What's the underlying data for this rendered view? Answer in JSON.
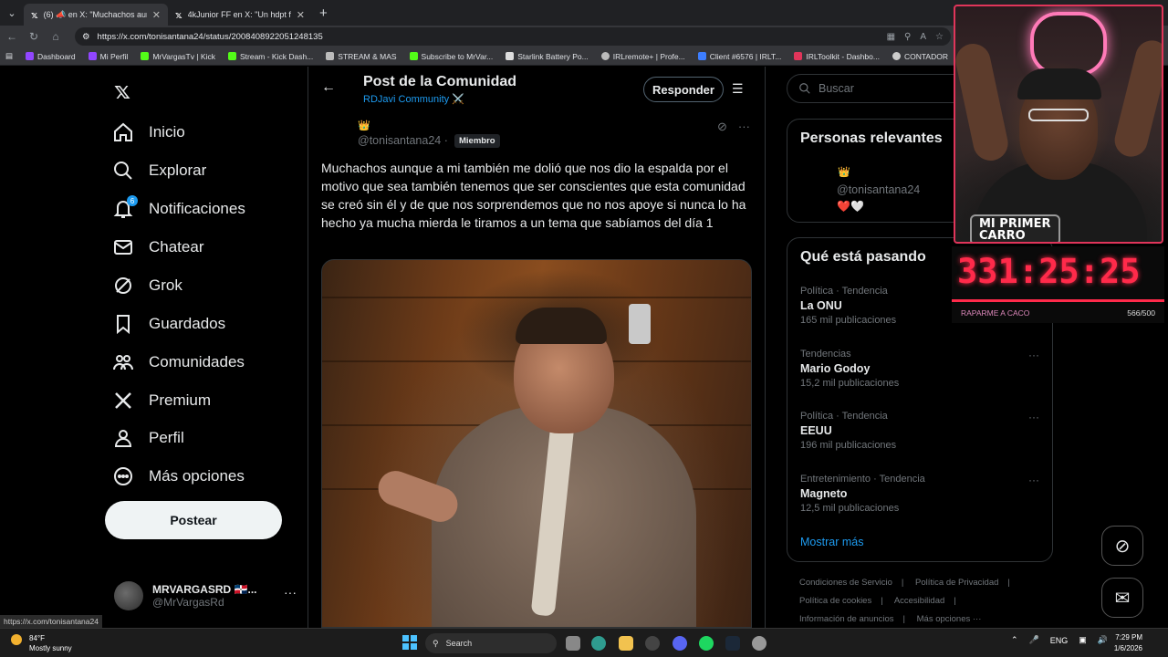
{
  "browser": {
    "tabs": [
      {
        "label": "(6) 📣 en X: \"Muchachos aunque",
        "active": true
      },
      {
        "label": "4kJunior FF en X: \"Un hdpt facto:",
        "active": false
      }
    ],
    "url": "https://x.com/tonisantana24/status/2008408922051248135",
    "bookmarks": [
      {
        "label": "Dashboard",
        "color": "#9146ff"
      },
      {
        "label": "Mi Perfil",
        "color": "#9146ff"
      },
      {
        "label": "MrVargasTv | Kick",
        "color": "#53fc18"
      },
      {
        "label": "Stream - Kick Dash...",
        "color": "#53fc18"
      },
      {
        "label": "STREAM & MAS",
        "color": "#bbbbbb"
      },
      {
        "label": "Subscribe to MrVar...",
        "color": "#53fc18"
      },
      {
        "label": "Starlink Battery Po...",
        "color": "#dddddd"
      },
      {
        "label": "IRLremote+ | Profe...",
        "color": "#bbbbbb"
      },
      {
        "label": "Client #6576 | IRLT...",
        "color": "#3d7eff"
      },
      {
        "label": "IRLToolkit - Dashbo...",
        "color": "#e0355a"
      },
      {
        "label": "CONTADOR",
        "color": "#cccccc"
      }
    ],
    "status_url": "https://x.com/tonisantana24"
  },
  "nav": {
    "items": [
      {
        "label": "Inicio",
        "icon": "home-icon"
      },
      {
        "label": "Explorar",
        "icon": "search-icon"
      },
      {
        "label": "Notificaciones",
        "icon": "bell-icon",
        "badge": "6"
      },
      {
        "label": "Chatear",
        "icon": "mail-icon"
      },
      {
        "label": "Grok",
        "icon": "grok-icon"
      },
      {
        "label": "Guardados",
        "icon": "bookmark-icon"
      },
      {
        "label": "Comunidades",
        "icon": "people-icon"
      },
      {
        "label": "Premium",
        "icon": "x-icon"
      },
      {
        "label": "Perfil",
        "icon": "person-icon"
      },
      {
        "label": "Más opciones",
        "icon": "more-circle-icon"
      }
    ],
    "post_button": "Postear",
    "account": {
      "name": "MRVARGASRD 🇩🇴...",
      "handle": "@MrVargasRd"
    }
  },
  "post": {
    "header_title": "Post de la Comunidad",
    "community": "RDJavi Community ⚔️",
    "reply_label": "Responder",
    "author_emoji": "👑",
    "author_handle": "@tonisantana24 ·",
    "member_badge": "Miembro",
    "text": "Muchachos aunque a mi también me dolió que nos dio la espalda por el motivo que sea también tenemos que ser conscientes que esta comunidad se creó sin él y de que nos sorprendemos  que no nos apoye si nunca lo ha hecho ya mucha mierda le tiramos a un tema que sabíamos del día 1"
  },
  "right": {
    "search_placeholder": "Buscar",
    "relevant_title": "Personas relevantes",
    "relevant_emoji": "👑",
    "relevant_handle": "@tonisantana24",
    "relevant_hearts": "❤️🤍",
    "trending_title": "Qué está pasando",
    "trends": [
      {
        "category": "Política · Tendencia",
        "name": "La ONU",
        "count": "165 mil publicaciones"
      },
      {
        "category": "Tendencias",
        "name": "Mario Godoy",
        "count": "15,2 mil publicaciones"
      },
      {
        "category": "Política · Tendencia",
        "name": "EEUU",
        "count": "196 mil publicaciones"
      },
      {
        "category": "Entretenimiento · Tendencia",
        "name": "Magneto",
        "count": "12,5 mil publicaciones"
      }
    ],
    "show_more": "Mostrar más",
    "footer": [
      "Condiciones de Servicio",
      "|",
      "Política de Privacidad",
      "|",
      "Política de cookies",
      "|",
      "Accesibilidad",
      "|",
      "Información de anuncios",
      "|",
      "Más opciones ···"
    ]
  },
  "overlay": {
    "cam_label_line1": "MI PRIMER",
    "cam_label_line2": "CARRO",
    "timer": "331:25:25",
    "goal_label": "RAPARME A CACO",
    "goal_count": "566/500"
  },
  "taskbar": {
    "temp": "84°F",
    "weather": "Mostly sunny",
    "search": "Search",
    "lang": "ENG",
    "time": "7:29 PM",
    "date": "1/6/2026"
  }
}
